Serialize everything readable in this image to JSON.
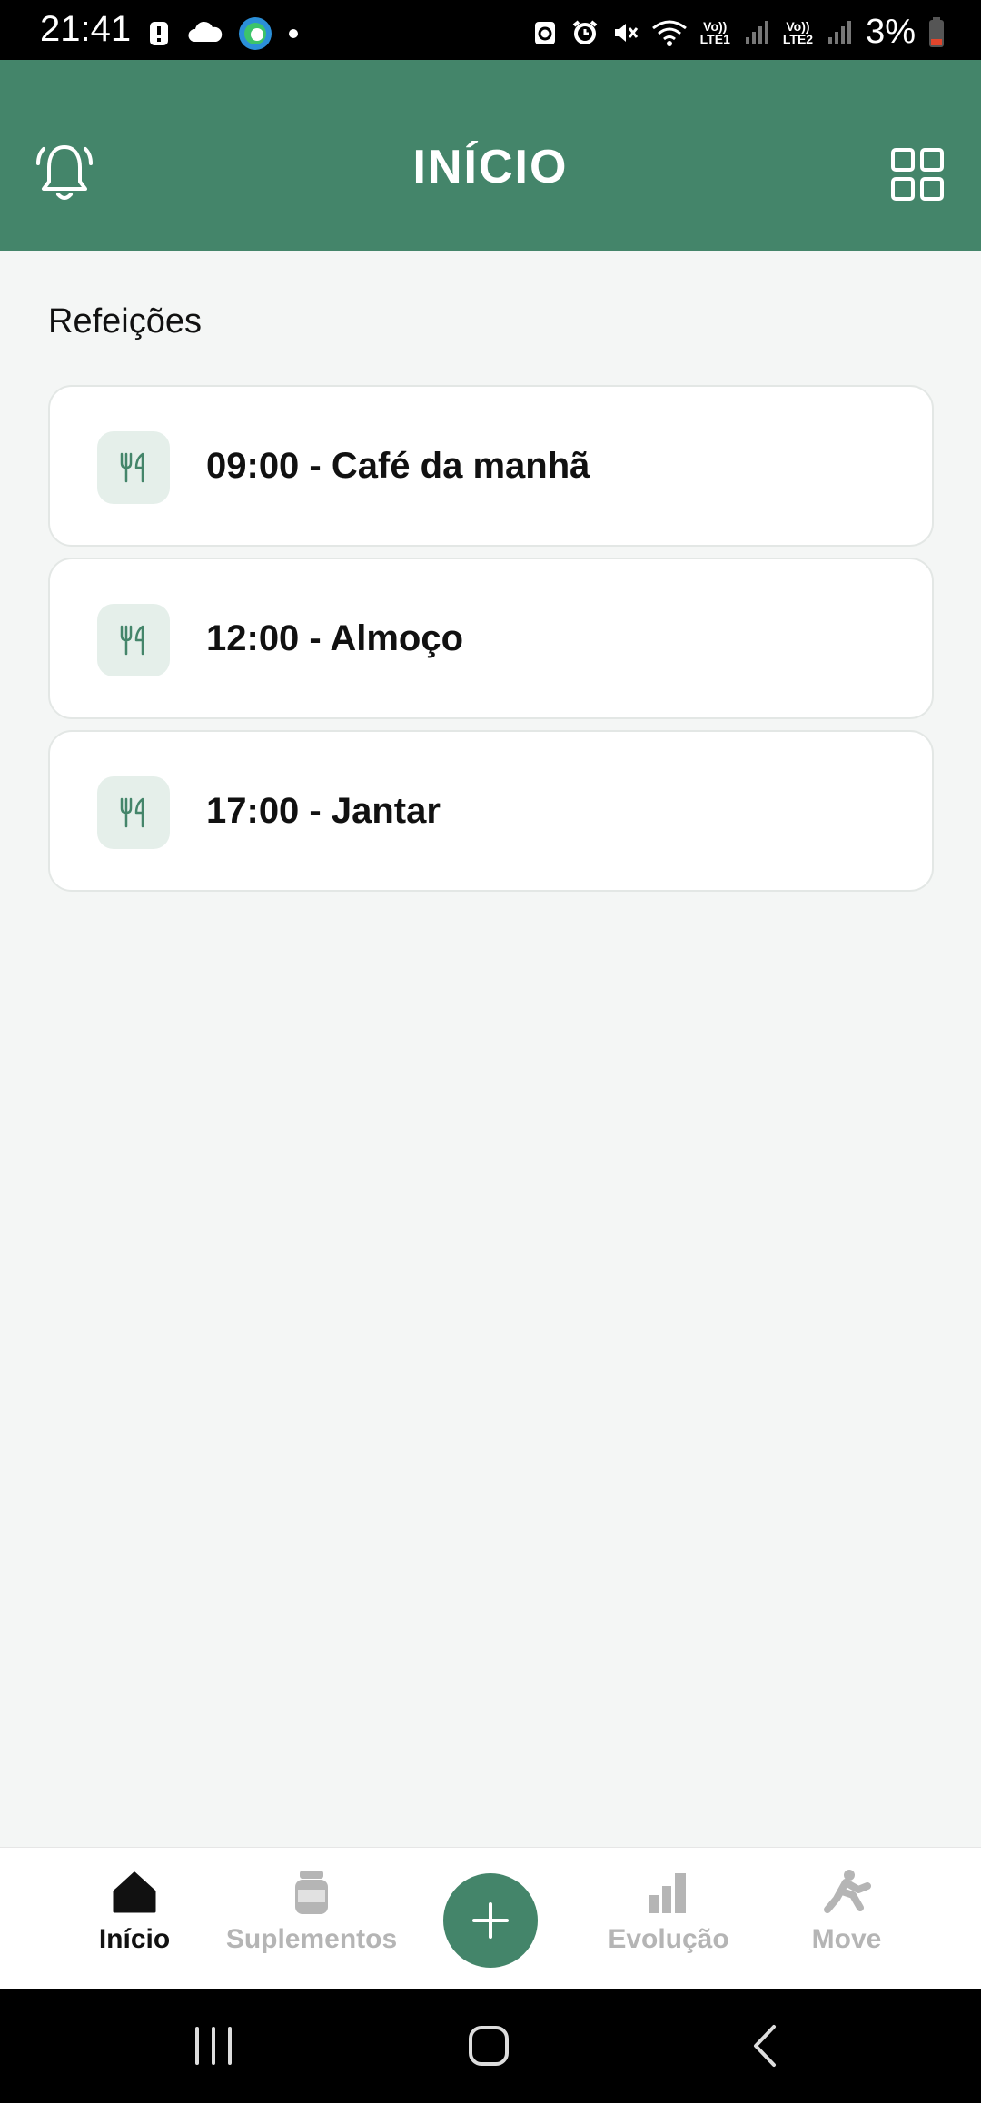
{
  "status_bar": {
    "time": "21:41",
    "battery_percent": "3%",
    "sim1_label": "LTE1",
    "sim2_label": "LTE2",
    "volte_label": "Vo))"
  },
  "header": {
    "title": "INÍCIO",
    "left_icon": "bell-icon",
    "right_icon": "grid-icon",
    "background_color": "#44856a"
  },
  "meals": {
    "section_title": "Refeições",
    "items": [
      {
        "label": "09:00 - Café da manhã",
        "icon": "fork-knife-icon"
      },
      {
        "label": "12:00 - Almoço",
        "icon": "fork-knife-icon"
      },
      {
        "label": "17:00 - Jantar",
        "icon": "fork-knife-icon"
      }
    ]
  },
  "bottom_nav": {
    "items": [
      {
        "label": "Início",
        "icon": "home-icon",
        "active": true
      },
      {
        "label": "Suplementos",
        "icon": "supplement-jar-icon",
        "active": false
      },
      {
        "label": "Evolução",
        "icon": "bar-chart-icon",
        "active": false
      },
      {
        "label": "Move",
        "icon": "running-person-icon",
        "active": false
      }
    ],
    "fab_icon": "plus-icon",
    "accent_color": "#44856a"
  },
  "system_nav": {
    "buttons": [
      "recents-icon",
      "home-circle-icon",
      "back-icon"
    ]
  }
}
